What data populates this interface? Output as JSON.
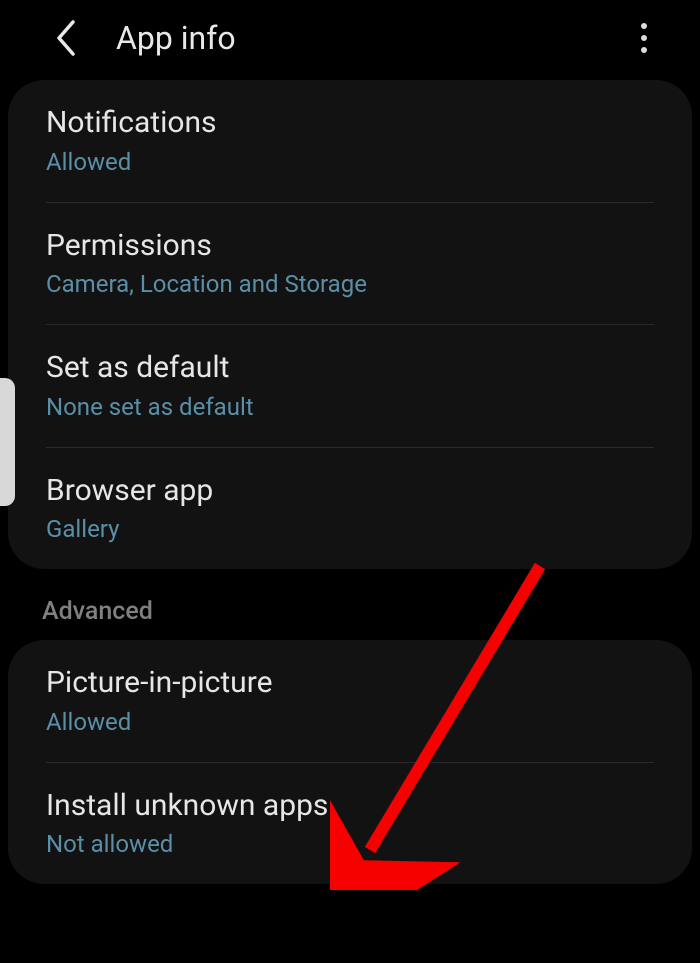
{
  "header": {
    "title": "App info"
  },
  "sections": [
    {
      "rows": [
        {
          "label": "Notifications",
          "sub": "Allowed"
        },
        {
          "label": "Permissions",
          "sub": "Camera, Location and Storage"
        },
        {
          "label": "Set as default",
          "sub": "None set as default"
        },
        {
          "label": "Browser app",
          "sub": "Gallery"
        }
      ]
    },
    {
      "header": "Advanced",
      "rows": [
        {
          "label": "Picture-in-picture",
          "sub": "Allowed"
        },
        {
          "label": "Install unknown apps",
          "sub": "Not allowed"
        }
      ]
    }
  ]
}
